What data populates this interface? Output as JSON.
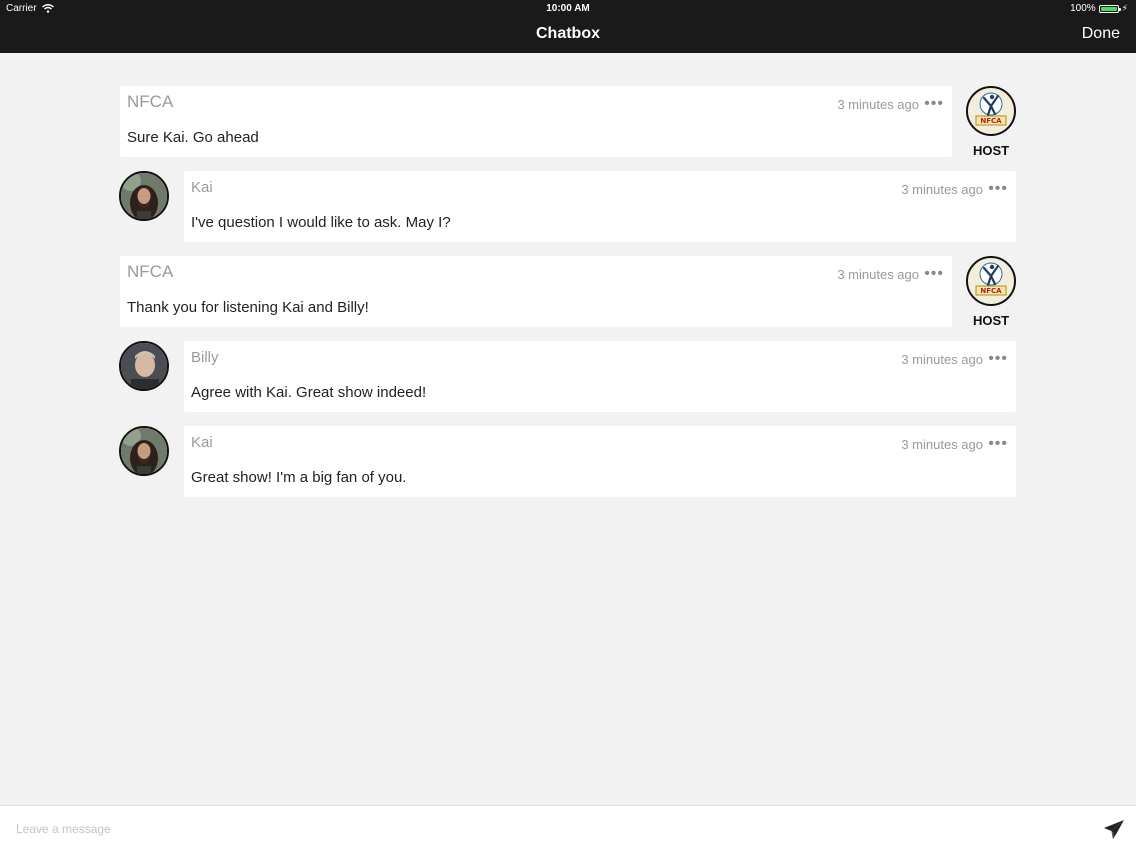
{
  "status_bar": {
    "carrier": "Carrier",
    "time": "10:00 AM",
    "battery": "100%"
  },
  "nav": {
    "title": "Chatbox",
    "done_label": "Done"
  },
  "messages": [
    {
      "author": "NFCA",
      "role": "host",
      "time": "3 minutes ago",
      "text": "Sure Kai. Go ahead",
      "badge": "HOST"
    },
    {
      "author": "Kai",
      "role": "user",
      "time": "3 minutes ago",
      "text": "I've question I would like to ask. May I?"
    },
    {
      "author": "NFCA",
      "role": "host",
      "time": "3 minutes ago",
      "text": "Thank you for listening Kai and Billy!",
      "badge": "HOST"
    },
    {
      "author": "Billy",
      "role": "user",
      "time": "3 minutes ago",
      "text": "Agree with Kai. Great show indeed!"
    },
    {
      "author": "Kai",
      "role": "user",
      "time": "3 minutes ago",
      "text": "Great show! I'm a big fan of you."
    }
  ],
  "menu_glyph": "•••",
  "logo_text": "NFCA",
  "composer": {
    "placeholder": "Leave a message",
    "value": ""
  },
  "icons": {
    "wifi": "wifi-icon",
    "battery": "battery-icon",
    "more": "more-icon",
    "send": "send-icon",
    "logo": "nfca-logo"
  },
  "colors": {
    "bar_bg": "#1a1a1a",
    "page_bg": "#f2f2f2",
    "battery_fill": "#4cd964",
    "muted_text": "#9a9a9a"
  }
}
